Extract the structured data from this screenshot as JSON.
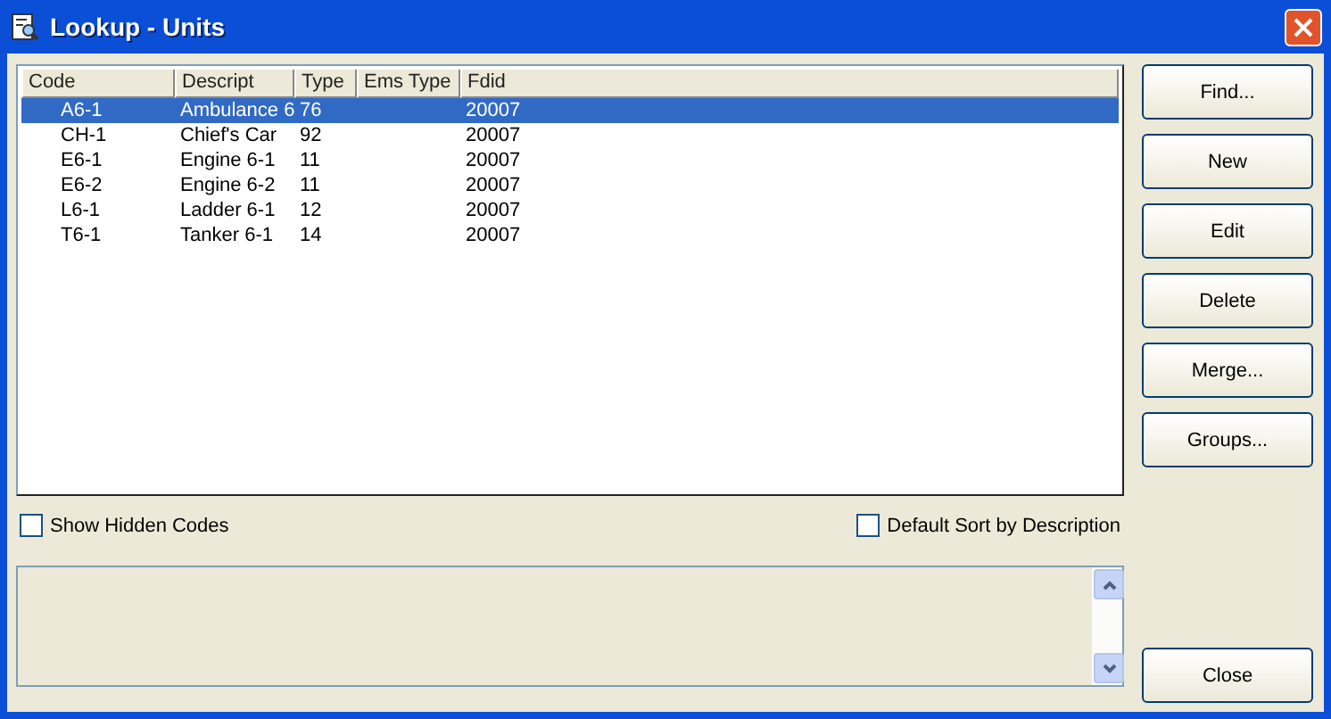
{
  "window": {
    "title": "Lookup - Units"
  },
  "table": {
    "columns": [
      "Code",
      "Descript",
      "Type",
      "Ems Type",
      "Fdid"
    ],
    "rows": [
      {
        "cells": [
          "A6-1",
          "Ambulance 6",
          "76",
          "",
          "20007"
        ],
        "selected": true
      },
      {
        "cells": [
          "CH-1",
          "Chief's Car",
          "92",
          "",
          "20007"
        ],
        "selected": false
      },
      {
        "cells": [
          "E6-1",
          "Engine 6-1",
          "11",
          "",
          "20007"
        ],
        "selected": false
      },
      {
        "cells": [
          "E6-2",
          "Engine 6-2",
          "11",
          "",
          "20007"
        ],
        "selected": false
      },
      {
        "cells": [
          "L6-1",
          "Ladder 6-1",
          "12",
          "",
          "20007"
        ],
        "selected": false
      },
      {
        "cells": [
          "T6-1",
          "Tanker 6-1",
          "14",
          "",
          "20007"
        ],
        "selected": false
      }
    ]
  },
  "checkboxes": [
    {
      "label": "Show Hidden Codes",
      "checked": false
    },
    {
      "label": "Default Sort by Description",
      "checked": false
    }
  ],
  "buttons": [
    "Find...",
    "New",
    "Edit",
    "Delete",
    "Merge...",
    "Groups..."
  ],
  "close_button": "Close"
}
